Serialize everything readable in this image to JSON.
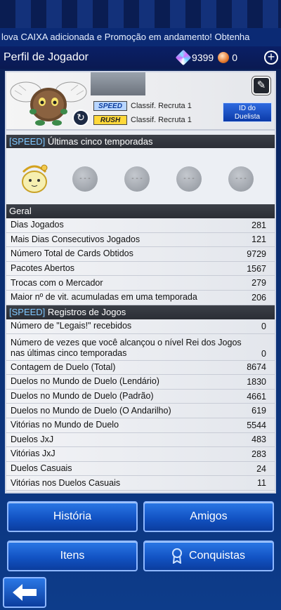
{
  "ticker": "lova CAIXA adicionada e Promoção em andamento! Obtenha",
  "header": {
    "title": "Perfil de Jogador",
    "gems": "9399",
    "orbs": "0"
  },
  "profile": {
    "speed_tag": "SPEED",
    "rush_tag": "RUSH",
    "speed_rank": "Classif. Recruta 1",
    "rush_rank": "Classif. Recruta 1",
    "id_button_line1": "ID do",
    "id_button_line2": "Duelista"
  },
  "seasons": {
    "header_prefix": "[SPEED]",
    "header_text": " Últimas cinco temporadas",
    "empty_slot": "- - -"
  },
  "general": {
    "header": "Geral",
    "rows": [
      {
        "label": "Dias Jogados",
        "value": "281"
      },
      {
        "label": "Mais Dias Consecutivos Jogados",
        "value": "121"
      },
      {
        "label": "Número Total de Cards Obtidos",
        "value": "9729"
      },
      {
        "label": "Pacotes Abertos",
        "value": "1567"
      },
      {
        "label": "Trocas com o Mercador",
        "value": "279"
      },
      {
        "label": "Maior nº de vit. acumuladas em uma temporada",
        "value": "206"
      }
    ]
  },
  "records": {
    "header_prefix": "[SPEED]",
    "header_text": " Registros de Jogos",
    "rows": [
      {
        "label": "Número de \"Legais!\" recebidos",
        "value": "0"
      },
      {
        "label": "Número de vezes que você alcançou o nível Rei dos Jogos nas últimas cinco temporadas",
        "value": "0"
      },
      {
        "label": "Contagem de Duelo (Total)",
        "value": "8674"
      },
      {
        "label": "Duelos no Mundo de Duelo (Lendário)",
        "value": "1830"
      },
      {
        "label": "Duelos no Mundo de Duelo (Padrão)",
        "value": "4661"
      },
      {
        "label": "Duelos no Mundo de Duelo (O Andarilho)",
        "value": "619"
      },
      {
        "label": "Vitórias no Mundo de Duelo",
        "value": "5544"
      },
      {
        "label": "Duelos JxJ",
        "value": "483"
      },
      {
        "label": "Vitórias JxJ",
        "value": "283"
      },
      {
        "label": "Duelos Casuais",
        "value": "24"
      },
      {
        "label": "Vitórias nos Duelos Casuais",
        "value": "11"
      }
    ]
  },
  "buttons": {
    "history": "História",
    "friends": "Amigos",
    "items": "Itens",
    "achievements": "Conquistas"
  }
}
